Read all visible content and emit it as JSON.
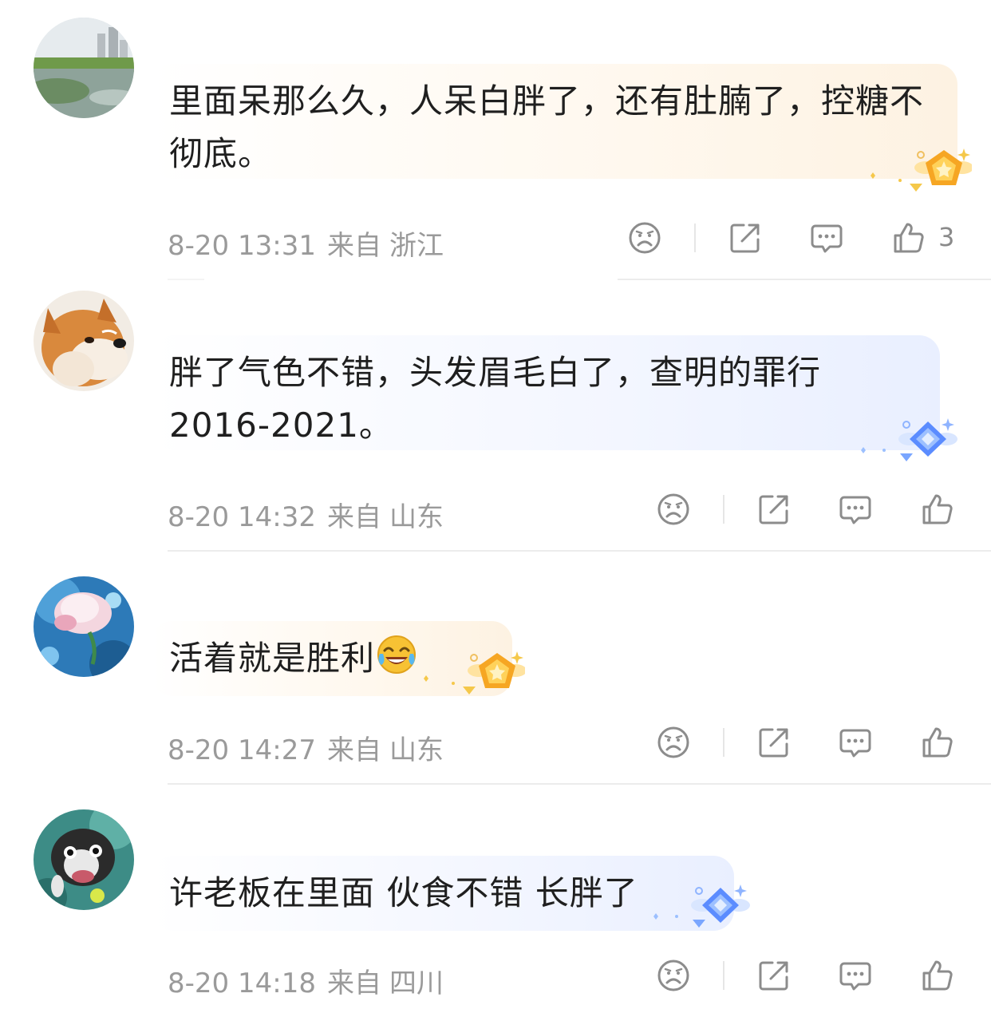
{
  "comments": [
    {
      "text": "里面呆那么久，人呆白胖了，还有肚腩了，控糖不彻底。",
      "time": "8-20 13:31",
      "from_label": "来自",
      "location": "浙江",
      "likes": "3",
      "avatar": "lake-landscape",
      "badge": "gold-star-badge"
    },
    {
      "text": "胖了气色不错，头发眉毛白了，查明的罪行2016-2021。",
      "time": "8-20 14:32",
      "from_label": "来自",
      "location": "山东",
      "likes": "",
      "avatar": "shiba-dog",
      "badge": "blue-diamond-badge"
    },
    {
      "text": "活着就是胜利",
      "time": "8-20 14:27",
      "from_label": "来自",
      "location": "山东",
      "likes": "",
      "avatar": "pink-lotus",
      "badge": "gold-star-badge",
      "emoji": "laughing-crying-emoji"
    },
    {
      "text": "许老板在里面 伙食不错 长胖了",
      "time": "8-20 14:18",
      "from_label": "来自",
      "location": "四川",
      "likes": "",
      "avatar": "underwater-dog",
      "badge": "blue-diamond-badge"
    }
  ],
  "icons": {
    "dislike": "sad-face-icon",
    "share": "share-icon",
    "reply": "comment-icon",
    "like": "thumbs-up-icon"
  },
  "colors": {
    "gold_bubble": "#fdf2e2",
    "blue_bubble": "#e9efff",
    "meta_text": "#9a9a9a",
    "icon_gray": "#8c8c8c"
  }
}
